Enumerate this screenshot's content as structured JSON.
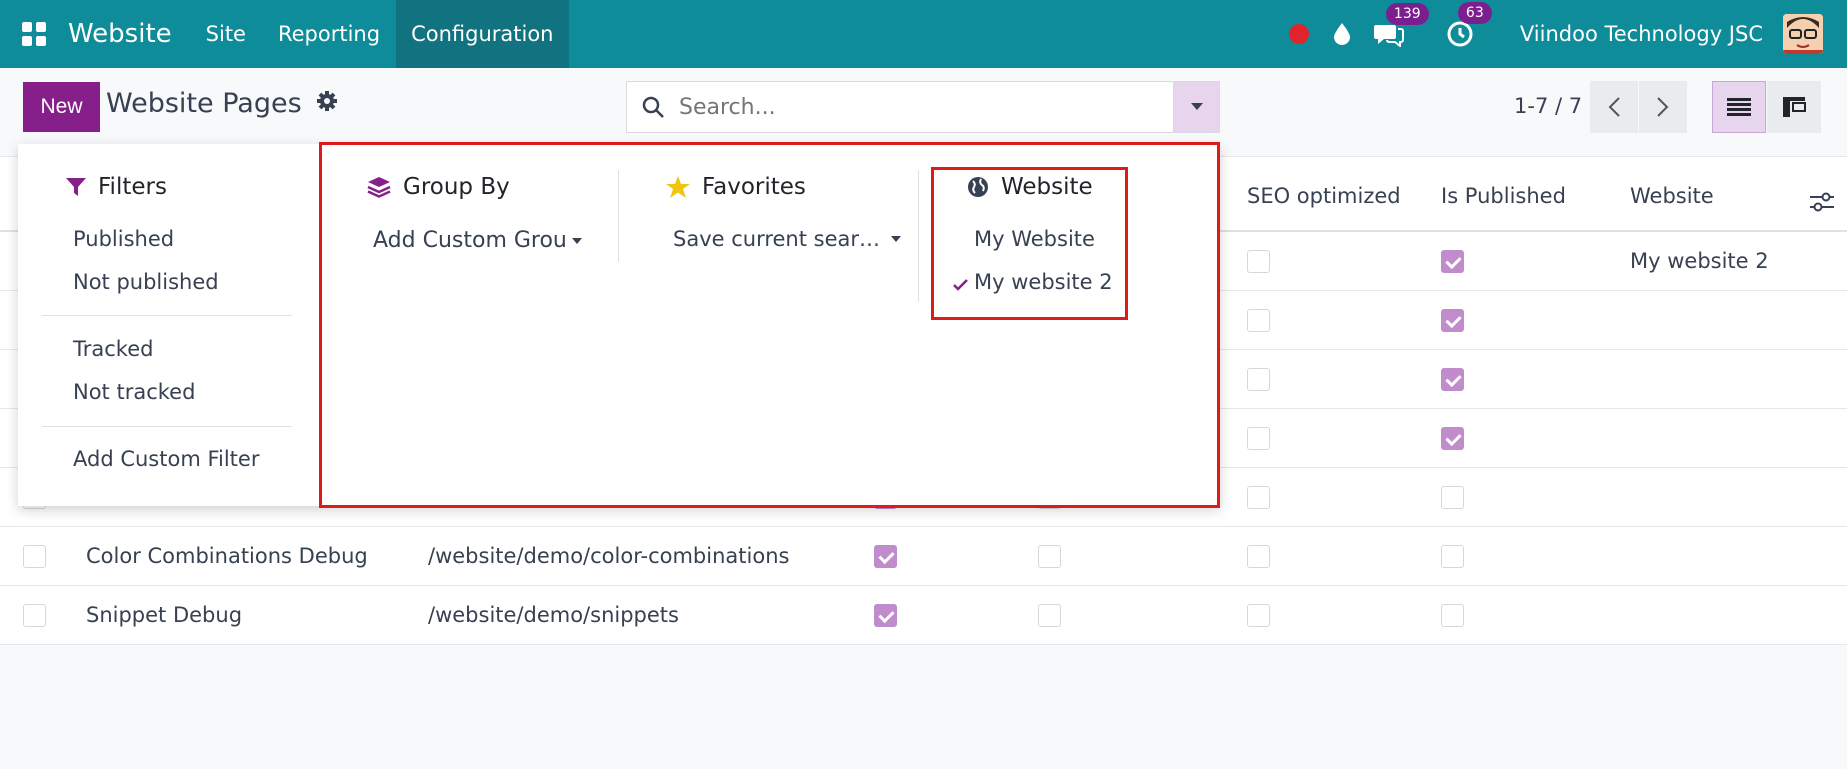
{
  "navbar": {
    "brand": "Website",
    "menus": [
      "Site",
      "Reporting",
      "Configuration"
    ],
    "messages_count": "139",
    "activities_count": "63",
    "company": "Viindoo Technology JSC",
    "colors": {
      "bg": "#0e8c9a",
      "active": "#10737f",
      "badge": "#7b1f8f"
    }
  },
  "control": {
    "new_label": "New",
    "title": "Website Pages",
    "search_placeholder": "Search...",
    "pager": "1-7 / 7"
  },
  "dropdown": {
    "filters": {
      "title": "Filters",
      "groups": [
        [
          "Published",
          "Not published"
        ],
        [
          "Tracked",
          "Not tracked"
        ],
        [
          "Add Custom Filter"
        ]
      ]
    },
    "group_by": {
      "title": "Group By",
      "item": "Add Custom Grou"
    },
    "favorites": {
      "title": "Favorites",
      "item": "Save current sear…"
    },
    "website": {
      "title": "Website",
      "items": [
        {
          "label": "My Website",
          "checked": false
        },
        {
          "label": "My website 2",
          "checked": true
        }
      ]
    }
  },
  "list": {
    "headers": [
      "SEO optimized",
      "Is Published",
      "Website"
    ],
    "rows": [
      {
        "name": "",
        "url": "",
        "indexed": true,
        "track": false,
        "seo": false,
        "published": true,
        "website": "My website 2"
      },
      {
        "name": "",
        "url": "",
        "indexed": true,
        "track": false,
        "seo": false,
        "published": true,
        "website": ""
      },
      {
        "name": "",
        "url": "",
        "indexed": true,
        "track": false,
        "seo": false,
        "published": true,
        "website": ""
      },
      {
        "name": "",
        "url": "",
        "indexed": true,
        "track": false,
        "seo": false,
        "published": true,
        "website": ""
      },
      {
        "name": "",
        "url": "",
        "indexed": true,
        "track": false,
        "seo": false,
        "published": false,
        "website": ""
      },
      {
        "name": "Color Combinations Debug",
        "url": "/website/demo/color-combinations",
        "indexed": true,
        "track": false,
        "seo": false,
        "published": false,
        "website": ""
      },
      {
        "name": "Snippet Debug",
        "url": "/website/demo/snippets",
        "indexed": true,
        "track": false,
        "seo": false,
        "published": false,
        "website": ""
      }
    ]
  }
}
